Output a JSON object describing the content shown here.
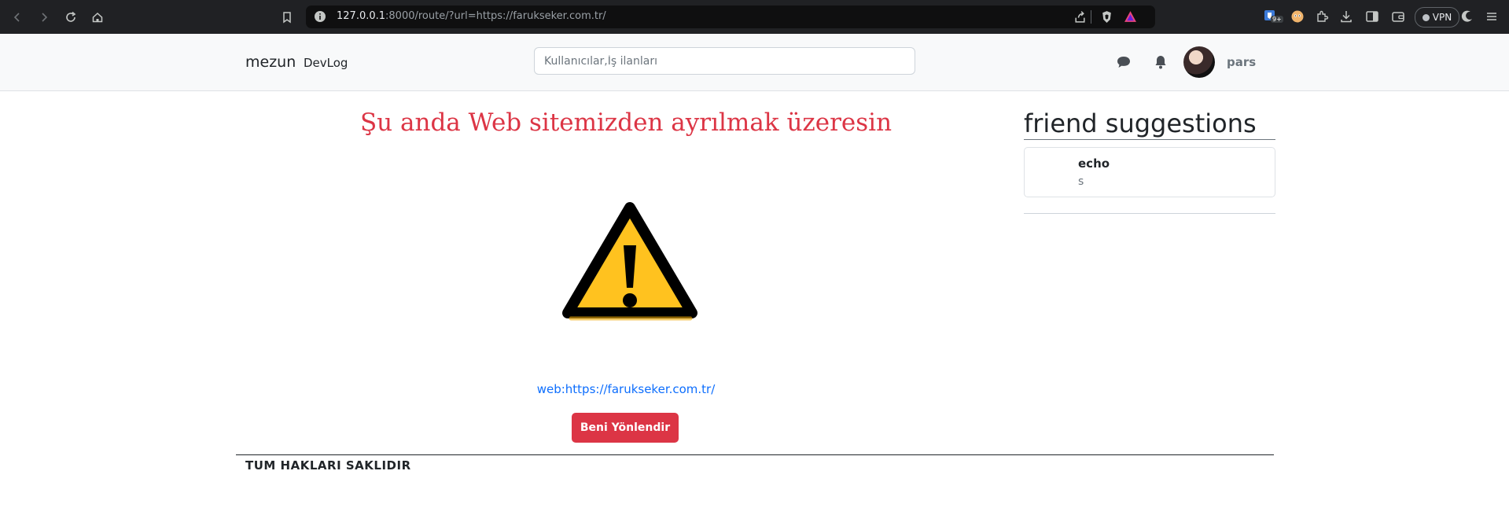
{
  "browser": {
    "url_host": "127.0.0.1",
    "url_rest": ":8000/route/?url=https://farukseker.com.tr/",
    "ext_badge": "9+",
    "vpn_label": "VPN",
    "colors": {
      "chrome_bg": "#202124",
      "address_bg": "#0f0f10"
    }
  },
  "navbar": {
    "brand": "mezun",
    "devlog_link": "DevLog",
    "search_placeholder": "Kullanıcılar,İş ilanları",
    "username": "pars",
    "icons": {
      "messages": "chat-bubble-icon",
      "notifications": "bell-icon"
    }
  },
  "main": {
    "headline": "Şu anda Web sitemizden ayrılmak üzeresin",
    "warning_icon": "warning-triangle-icon",
    "web_link": "web:https://farukseker.com.tr/",
    "redirect_button": "Beni Yönlendir",
    "colors": {
      "headline": "#dc3545",
      "button": "#dc3545",
      "link": "#0d6efd",
      "warning_fill": "#ffc21f"
    }
  },
  "sidebar": {
    "title": "friend suggestions",
    "suggestions": [
      {
        "name": "echo",
        "subtitle": "s"
      }
    ]
  },
  "footer": {
    "text": "TUM HAKLARI SAKLIDIR"
  }
}
